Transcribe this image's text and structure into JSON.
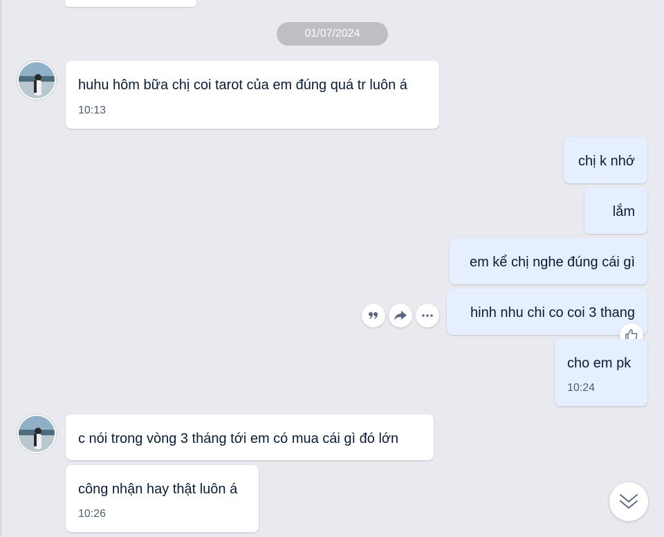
{
  "date_separator": "01/07/2024",
  "messages": {
    "m1": {
      "text": "huhu hôm bữa chị coi tarot của em đúng quá tr luôn á",
      "time": "10:13"
    },
    "m2": {
      "text": "chị k nhớ"
    },
    "m3": {
      "text": "lắm"
    },
    "m4": {
      "text": "em kể chị nghe đúng cái gì"
    },
    "m5": {
      "text": "hinh nhu chi co coi 3 thang"
    },
    "m6": {
      "text": "cho em pk",
      "time": "10:24"
    },
    "m7": {
      "text": "c nói trong vòng 3 tháng tới em có mua cái gì đó lớn"
    },
    "m8": {
      "text": "công nhận hay thật luôn á",
      "time": "10:26"
    }
  },
  "icons": {
    "quote": "quote-icon",
    "forward": "forward-share-icon",
    "more": "more-options-icon",
    "like": "thumbs-up-icon",
    "scroll_down": "double-chevron-down-icon"
  },
  "colors": {
    "background": "#e9eaef",
    "incoming_bubble": "#ffffff",
    "outgoing_bubble": "#e5efff",
    "date_pill": "#bdbfc4",
    "text": "#081c36",
    "time_text": "#4f5c6e",
    "icon": "#5a6981"
  }
}
